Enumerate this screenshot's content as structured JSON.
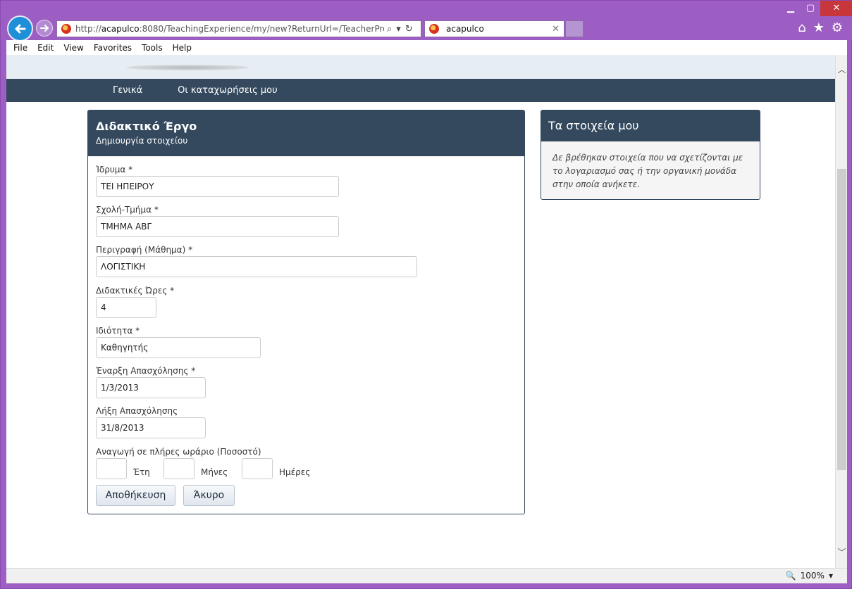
{
  "browser": {
    "url_prefix": "http://",
    "url_host": "acapulco",
    "url_rest": ":8080/TeachingExperience/my/new?ReturnUrl=/TeacherProfile.aspx",
    "tab_title": "acapulco",
    "menu": [
      "File",
      "Edit",
      "View",
      "Favorites",
      "Tools",
      "Help"
    ],
    "zoom": "100%"
  },
  "nav": {
    "links": [
      "Γενικά",
      "Οι καταχωρήσεις μου"
    ]
  },
  "form": {
    "title": "Διδακτικό Έργο",
    "subtitle": "Δημιουργία στοιχείου",
    "fields": [
      {
        "label": "Ίδρυμα *",
        "value": "ΤΕΙ ΗΠΕΙΡΟΥ"
      },
      {
        "label": "Σχολή-Τμήμα *",
        "value": "ΤΜΗΜΑ ΑΒΓ"
      },
      {
        "label": "Περιγραφή (Μάθημα) *",
        "value": "ΛΟΓΙΣΤΙΚΗ"
      },
      {
        "label": "Διδακτικές Ώρες *",
        "value": "4"
      },
      {
        "label": "Ιδιότητα *",
        "value": "Καθηγητής"
      },
      {
        "label": "Έναρξη Απασχόλησης *",
        "value": "1/3/2013"
      },
      {
        "label": "Λήξη Απασχόλησης",
        "value": "31/8/2013"
      }
    ],
    "reduction_label": "Αναγωγή σε πλήρες ωράριο (Ποσοστό)",
    "years_label": "Έτη",
    "months_label": "Μήνες",
    "days_label": "Ημέρες",
    "save_label": "Αποθήκευση",
    "cancel_label": "Άκυρο"
  },
  "side": {
    "title": "Τα στοιχεία μου",
    "message": "Δε βρέθηκαν στοιχεία που να σχετίζονται με το λογαριασμό σας ή την οργανική μονάδα στην οποία ανήκετε."
  },
  "colors": {
    "header": "#34495e",
    "browser_frame": "#9d5ec3"
  }
}
